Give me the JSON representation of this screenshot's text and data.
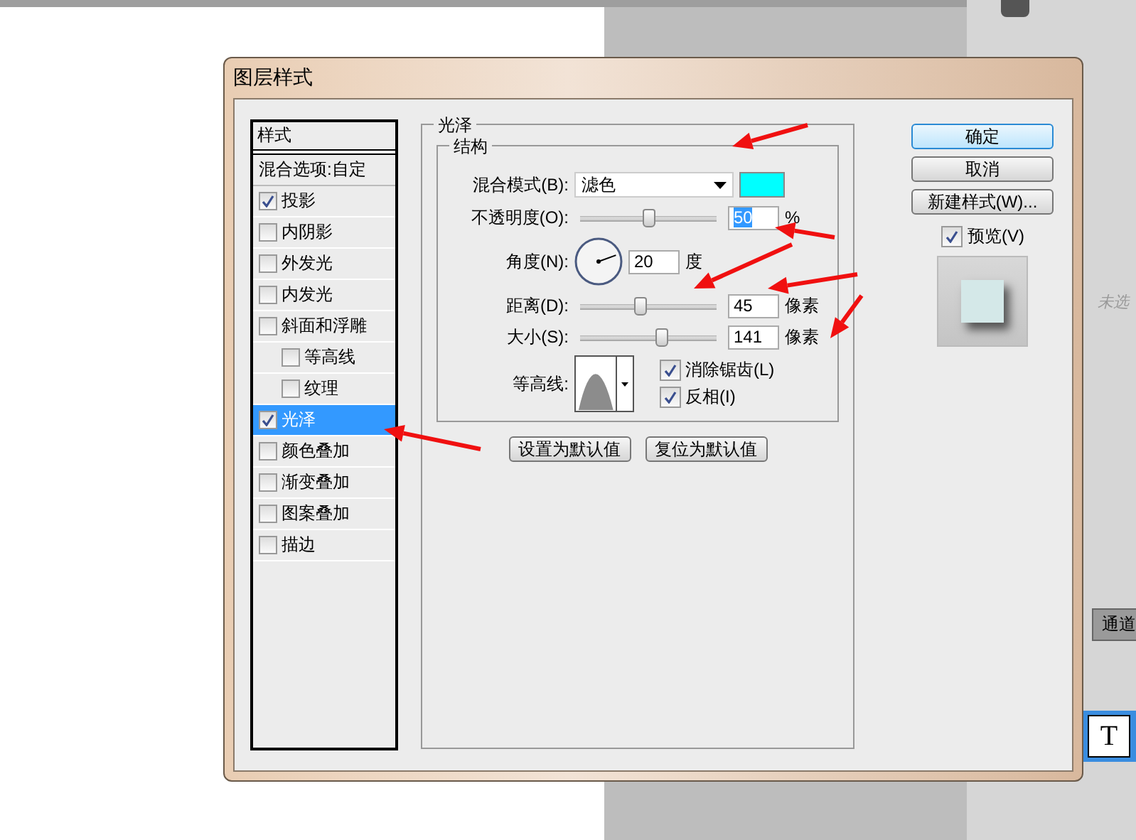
{
  "window": {
    "title": "图层样式"
  },
  "styles": {
    "header": "样式",
    "items": [
      {
        "label": "混合选项:自定",
        "kind": "blend",
        "selected": false
      },
      {
        "label": "投影",
        "kind": "check",
        "checked": true,
        "selected": false
      },
      {
        "label": "内阴影",
        "kind": "check",
        "checked": false,
        "selected": false
      },
      {
        "label": "外发光",
        "kind": "check",
        "checked": false,
        "selected": false
      },
      {
        "label": "内发光",
        "kind": "check",
        "checked": false,
        "selected": false
      },
      {
        "label": "斜面和浮雕",
        "kind": "check",
        "checked": false,
        "selected": false,
        "children": [
          {
            "label": "等高线",
            "kind": "check",
            "checked": false,
            "selected": false
          },
          {
            "label": "纹理",
            "kind": "check",
            "checked": false,
            "selected": false
          }
        ]
      },
      {
        "label": "光泽",
        "kind": "check",
        "checked": true,
        "selected": true
      },
      {
        "label": "颜色叠加",
        "kind": "check",
        "checked": false,
        "selected": false
      },
      {
        "label": "渐变叠加",
        "kind": "check",
        "checked": false,
        "selected": false
      },
      {
        "label": "图案叠加",
        "kind": "check",
        "checked": false,
        "selected": false
      },
      {
        "label": "描边",
        "kind": "check",
        "checked": false,
        "selected": false
      }
    ]
  },
  "panel": {
    "title": "光泽",
    "group": "结构",
    "rows": [
      {
        "kind": "select",
        "label": "混合模式(B):",
        "value": "滤色",
        "color": "#00ffff"
      },
      {
        "kind": "slider",
        "label": "不透明度(O):",
        "value": "50",
        "unit": "%",
        "level": 0.5,
        "value_selected": true
      },
      {
        "kind": "dial",
        "label": "角度(N):",
        "value": "20",
        "unit": "度"
      },
      {
        "kind": "slider",
        "label": "距离(D):",
        "value": "45",
        "unit": "像素",
        "level": 0.44,
        "value_selected": false
      },
      {
        "kind": "slider",
        "label": "大小(S):",
        "value": "141",
        "unit": "像素",
        "level": 0.59,
        "value_selected": false
      }
    ],
    "contour": {
      "label": "等高线:",
      "options": [
        {
          "label": "消除锯齿(L)",
          "checked": true
        },
        {
          "label": "反相(I)",
          "checked": true
        }
      ]
    },
    "buttons": [
      "设置为默认值",
      "复位为默认值"
    ]
  },
  "actions": [
    {
      "label": "确定",
      "default": true
    },
    {
      "label": "取消",
      "default": false
    },
    {
      "label": "新建样式(W)...",
      "default": false
    }
  ],
  "preview": {
    "label": "预览(V)",
    "checked": true
  },
  "side_panel": {
    "layer_hint": "未选",
    "tab": "通道",
    "thumbnail": "T"
  }
}
